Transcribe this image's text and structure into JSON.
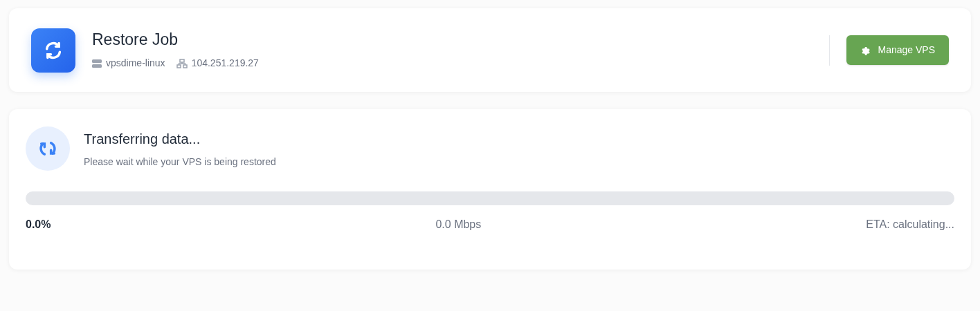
{
  "header": {
    "title": "Restore Job",
    "server_name": "vpsdime-linux",
    "ip_address": "104.251.219.27",
    "button": "Manage VPS"
  },
  "progress": {
    "title": "Transferring data...",
    "subtitle": "Please wait while your VPS is being restored",
    "level": 0,
    "percent": "0.0%",
    "speed": "0.0 Mbps",
    "eta": "ETA: calculating..."
  }
}
